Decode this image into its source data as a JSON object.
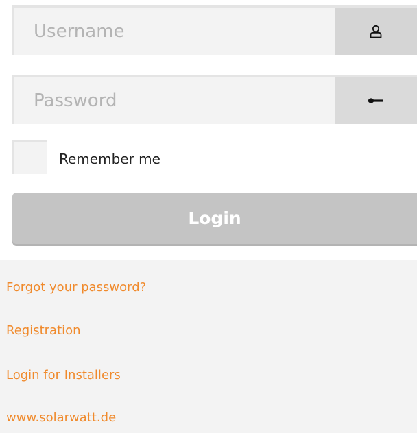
{
  "login_form": {
    "username": {
      "placeholder": "Username",
      "value": "",
      "icon": "user-icon"
    },
    "password": {
      "placeholder": "Password",
      "value": "",
      "icon": "key-icon"
    },
    "remember_me": {
      "label": "Remember me",
      "checked": false
    },
    "login_button_label": "Login"
  },
  "links": {
    "forgot_password": "Forgot your password?",
    "registration": "Registration",
    "installers_login": "Login for Installers",
    "website": "www.solarwatt.de"
  },
  "colors": {
    "link": "#f08a2c",
    "button_background": "#c4c4c4",
    "field_background": "#f3f3f3",
    "icon_addon_background": "#d7d7d7"
  }
}
